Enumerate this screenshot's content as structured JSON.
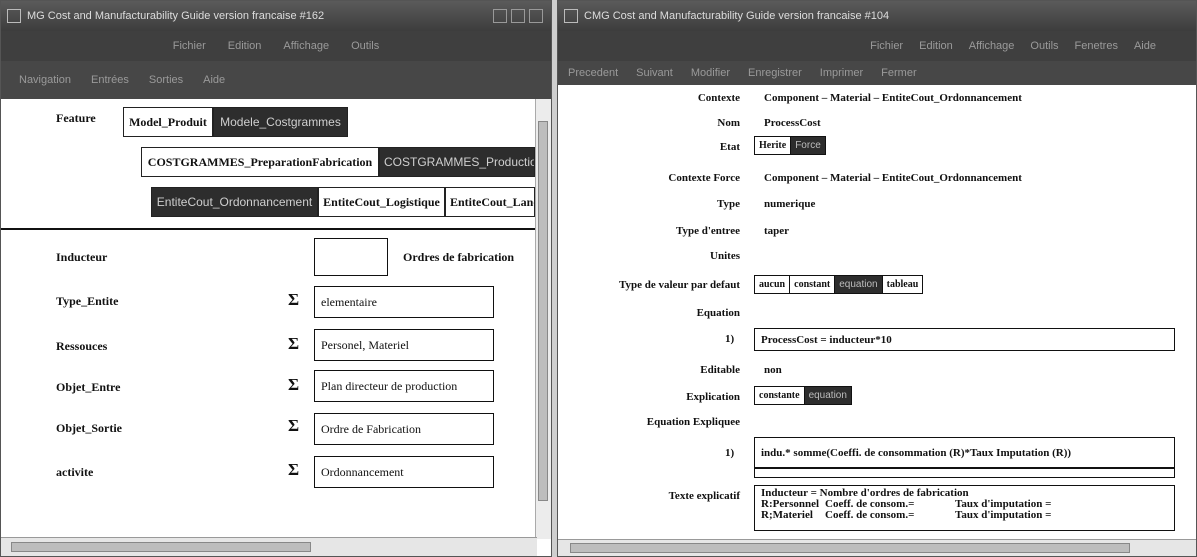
{
  "window1": {
    "title": "MG  Cost and Manufacturability Guide version francaise   #162",
    "menu": [
      "Fichier",
      "Edition",
      "Affichage",
      "Outils"
    ],
    "toolbar": [
      "Navigation",
      "Entrées",
      "Sorties",
      "Aide"
    ],
    "feature_label": "Feature",
    "row1": [
      "Model_Produit",
      "Modele_Costgrammes"
    ],
    "row2": [
      "COSTGRAMMES_PreparationFabrication",
      "COSTGRAMMES_Production"
    ],
    "row3": [
      "EntiteCout_Ordonnancement",
      "EntiteCout_Logistique",
      "EntiteCout_Lancement"
    ],
    "inducteur": {
      "label": "Inducteur",
      "value": "",
      "suffix": "Ordres de fabrication"
    },
    "props": [
      {
        "label": "Type_Entite",
        "value": "elementaire"
      },
      {
        "label": "Ressouces",
        "value": "Personel, Materiel"
      },
      {
        "label": "Objet_Entre",
        "value": "Plan directeur de production"
      },
      {
        "label": "Objet_Sortie",
        "value": "Ordre de Fabrication"
      },
      {
        "label": "activite",
        "value": "Ordonnancement"
      }
    ],
    "sigma": "Σ"
  },
  "window2": {
    "title": "CMG  Cost and Manufacturability Guide version francaise   #104",
    "menu": [
      "Fichier",
      "Edition",
      "Affichage",
      "Outils",
      "Fenetres",
      "Aide"
    ],
    "toolbar": [
      "Precedent",
      "Suivant",
      "Modifier",
      "Enregistrer",
      "Imprimer",
      "Fermer"
    ],
    "contexte": {
      "label": "Contexte",
      "value": "Component – Material – EntiteCout_Ordonnancement"
    },
    "nom": {
      "label": "Nom",
      "value": "ProcessCost"
    },
    "etat": {
      "label": "Etat",
      "options": [
        "Herite",
        "Force"
      ],
      "selected": "Force"
    },
    "contexte_force": {
      "label": "Contexte Force",
      "value": "Component – Material – EntiteCout_Ordonnancement"
    },
    "type": {
      "label": "Type",
      "value": "numerique"
    },
    "type_entree": {
      "label": "Type d'entree",
      "value": "taper"
    },
    "unites": {
      "label": "Unites",
      "value": ""
    },
    "type_valeur": {
      "label": "Type de valeur par defaut",
      "options": [
        "aucun",
        "constant",
        "equation",
        "tableau"
      ],
      "selected": "equation"
    },
    "equation": {
      "label": "Equation",
      "index": "1)",
      "value": "ProcessCost = inducteur*10"
    },
    "editable": {
      "label": "Editable",
      "value": "non"
    },
    "explication": {
      "label": "Explication",
      "options": [
        "constante",
        "equation"
      ],
      "selected": "equation"
    },
    "equation_expliquee": {
      "label": "Equation Expliquee",
      "index": "1)",
      "value": "indu.* somme(Coeffi. de consommation (R)*Taux Imputation (R))"
    },
    "texte_explicatif": {
      "label": "Texte explicatif",
      "line1": "Inducteur = Nombre d'ordres de fabrication",
      "rows": [
        [
          "R:Personnel",
          "Coeff. de consom.=",
          "Taux d'imputation ="
        ],
        [
          "R;Materiel",
          "Coeff. de consom.=",
          "Taux d'imputation ="
        ]
      ]
    }
  }
}
